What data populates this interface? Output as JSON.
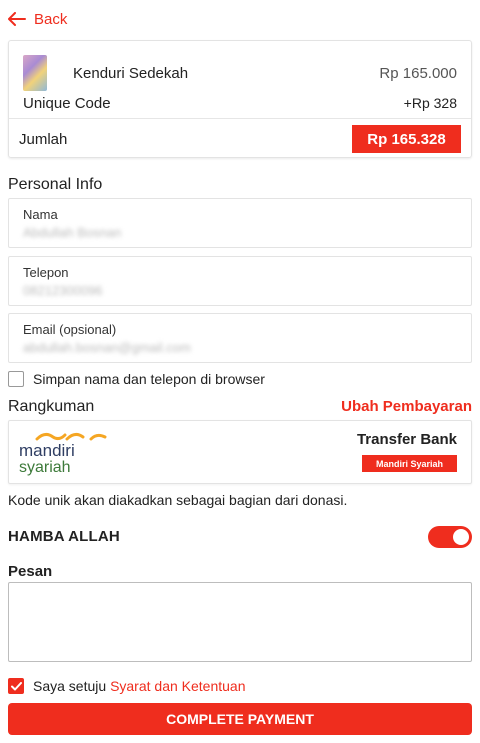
{
  "nav": {
    "back_label": "Back"
  },
  "summary": {
    "item_title": "Kenduri Sedekah",
    "item_price": "Rp 165.000",
    "unique_code_label": "Unique Code",
    "unique_code_value": "+Rp 328",
    "total_label": "Jumlah",
    "total_value": "Rp 165.328"
  },
  "personal_info": {
    "title": "Personal Info",
    "name": {
      "label": "Nama",
      "value": "Abdullah Bosnan"
    },
    "phone": {
      "label": "Telepon",
      "value": "08212300096"
    },
    "email": {
      "label": "Email (opsional)",
      "value": "abdullah.bosnan@gmail.com"
    },
    "save_checkbox_label": "Simpan nama dan telepon di browser",
    "save_checked": false
  },
  "summary_section": {
    "title": "Rangkuman",
    "change_payment_label": "Ubah Pembayaran",
    "bank_logo_word1": "mandiri",
    "bank_logo_word2": "syariah",
    "method_label": "Transfer Bank",
    "bank_badge": "Mandiri Syariah",
    "note": "Kode unik akan diakadkan sebagai bagian dari donasi."
  },
  "anonymous": {
    "label": "HAMBA ALLAH",
    "enabled": true
  },
  "message": {
    "label": "Pesan",
    "value": "",
    "placeholder": ""
  },
  "agreement": {
    "prefix": "Saya setuju",
    "link": "Syarat dan Ketentuan",
    "checked": true
  },
  "cta": {
    "label": "COMPLETE PAYMENT"
  },
  "colors": {
    "accent": "#ef2d1e",
    "bank_navy": "#2f3e63",
    "bank_orange": "#f5a623"
  }
}
